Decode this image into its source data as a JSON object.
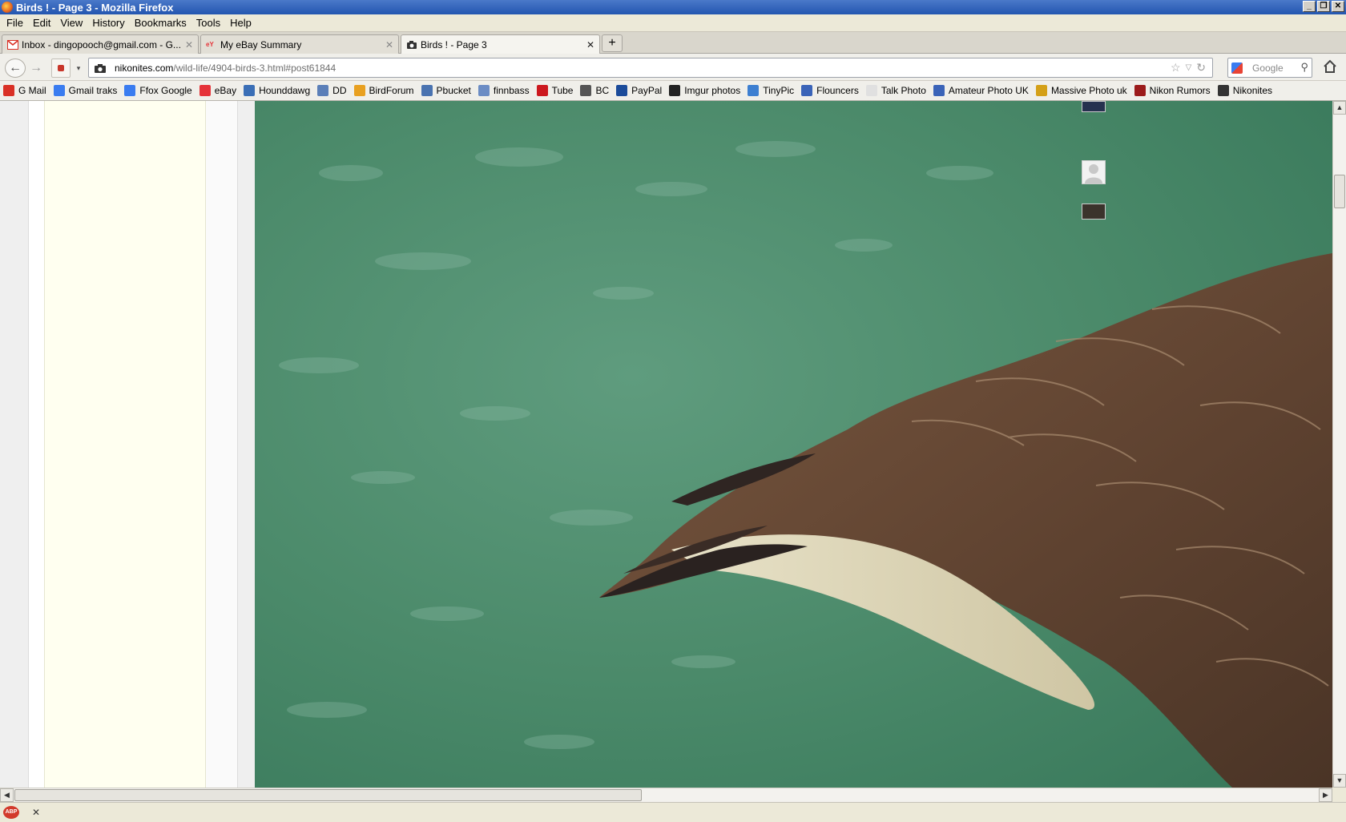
{
  "window": {
    "title": "Birds ! - Page 3 - Mozilla Firefox",
    "controls": [
      "_",
      "❐",
      "✕"
    ]
  },
  "menu": [
    "File",
    "Edit",
    "View",
    "History",
    "Bookmarks",
    "Tools",
    "Help"
  ],
  "tabs": [
    {
      "label": "Inbox - dingopooch@gmail.com - G...",
      "icon": "gmail-icon",
      "active": false
    },
    {
      "label": "My eBay Summary",
      "icon": "ebay-icon",
      "active": false
    },
    {
      "label": "Birds ! - Page 3",
      "icon": "camera-icon",
      "active": true
    }
  ],
  "newtab_label": "+",
  "nav": {
    "url_host": "nikonites.com",
    "url_path": "/wild-life/4904-birds-3.html#post61844",
    "search_placeholder": "Google"
  },
  "bookmarks": [
    {
      "label": "G Mail",
      "icon": "gmail-icon",
      "color": "#d93025"
    },
    {
      "label": "Gmail traks",
      "icon": "google-icon",
      "color": "#3a7cf0"
    },
    {
      "label": "Ffox Google",
      "icon": "google-icon",
      "color": "#3a7cf0"
    },
    {
      "label": "eBay",
      "icon": "ebay-icon",
      "color": "#e53238"
    },
    {
      "label": "Hounddawg",
      "icon": "globe-icon",
      "color": "#3b6fb6"
    },
    {
      "label": "DD",
      "icon": "page-icon",
      "color": "#5b7fb8"
    },
    {
      "label": "BirdForum",
      "icon": "bird-icon",
      "color": "#e8a020"
    },
    {
      "label": "Pbucket",
      "icon": "photo-icon",
      "color": "#4a73b0"
    },
    {
      "label": "finnbass",
      "icon": "page-icon",
      "color": "#6b8cc4"
    },
    {
      "label": "Tube",
      "icon": "youtube-icon",
      "color": "#cc181e"
    },
    {
      "label": "BC",
      "icon": "page-icon",
      "color": "#555555"
    },
    {
      "label": "PayPal",
      "icon": "paypal-icon",
      "color": "#1b4b9a"
    },
    {
      "label": "Imgur photos",
      "icon": "imgur-icon",
      "color": "#222222"
    },
    {
      "label": "TinyPic",
      "icon": "page-icon",
      "color": "#3d7fd1"
    },
    {
      "label": "Flouncers",
      "icon": "photo-icon",
      "color": "#3a63b8"
    },
    {
      "label": "Talk Photo",
      "icon": "cloud-icon",
      "color": "#e0e0e0"
    },
    {
      "label": "Amateur Photo UK",
      "icon": "camera-icon",
      "color": "#3a63b8"
    },
    {
      "label": "Massive Photo uk",
      "icon": "m-icon",
      "color": "#d4a017"
    },
    {
      "label": "Nikon Rumors",
      "icon": "nr-icon",
      "color": "#9b1b1b"
    },
    {
      "label": "Nikonites",
      "icon": "camera-icon",
      "color": "#333333"
    }
  ],
  "colors": {
    "water": "#4f8f6f",
    "feather_brown": "#6b4a34",
    "sidebar_cream": "#fffff0"
  }
}
